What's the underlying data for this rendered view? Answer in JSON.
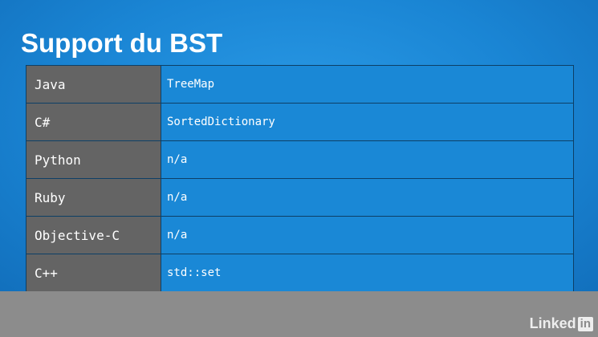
{
  "slide": {
    "title": "Support du BST"
  },
  "table": {
    "rows": [
      {
        "language": "Java",
        "implementation": "TreeMap"
      },
      {
        "language": "C#",
        "implementation": "SortedDictionary"
      },
      {
        "language": "Python",
        "implementation": "n/a"
      },
      {
        "language": "Ruby",
        "implementation": "n/a"
      },
      {
        "language": "Objective-C",
        "implementation": "n/a"
      },
      {
        "language": "C++",
        "implementation": "std::set"
      }
    ]
  },
  "watermark": {
    "text": "Linked",
    "badge": "in"
  },
  "colors": {
    "slide_background": "#1a85d4",
    "language_cell": "#646464",
    "implementation_cell": "#1a88d6",
    "bottom_bar": "#8c8c8c"
  }
}
